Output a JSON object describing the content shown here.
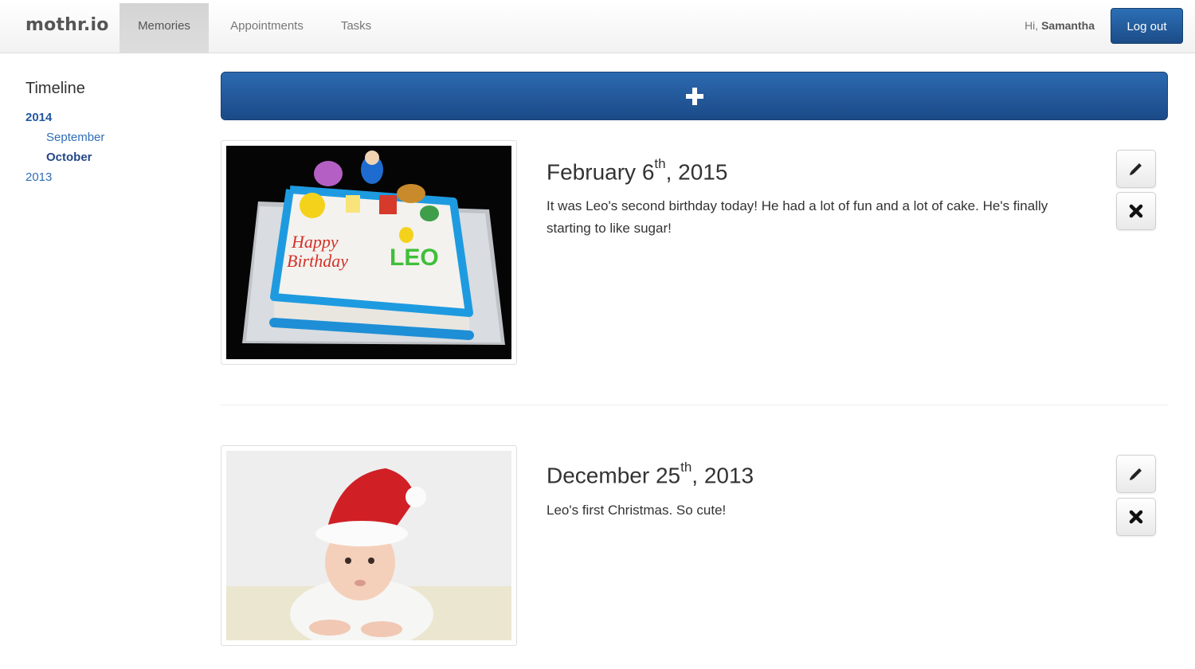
{
  "nav": {
    "brand": "mothr.io",
    "tabs": [
      "Memories",
      "Appointments",
      "Tasks"
    ],
    "active_tab": "Memories",
    "greeting_prefix": "Hi,",
    "user_name": "Samantha",
    "logout_label": "Log out"
  },
  "sidebar": {
    "title": "Timeline",
    "items": [
      {
        "label": "2014",
        "level": "year",
        "active": true
      },
      {
        "label": "September",
        "level": "month",
        "active": false
      },
      {
        "label": "October",
        "level": "month",
        "active": true
      },
      {
        "label": "2013",
        "level": "year",
        "active": false
      }
    ]
  },
  "add_button": {
    "icon": "plus-icon"
  },
  "memories": [
    {
      "date_prefix": "February 6",
      "date_suffix": "th",
      "date_year": ", 2015",
      "text": "It was Leo's second birthday today! He had a lot of fun and a lot of cake. He's finally starting to like sugar!",
      "image": "birthday-cake-photo",
      "edit_icon": "pencil-icon",
      "delete_icon": "close-icon"
    },
    {
      "date_prefix": "December 25",
      "date_suffix": "th",
      "date_year": ", 2013",
      "text": "Leo's first Christmas. So cute!",
      "image": "baby-santa-hat-photo",
      "edit_icon": "pencil-icon",
      "delete_icon": "close-icon"
    }
  ],
  "colors": {
    "primary": "#1f5596",
    "link": "#2f6fb7",
    "active_tab_bg": "#d8d8d8"
  }
}
